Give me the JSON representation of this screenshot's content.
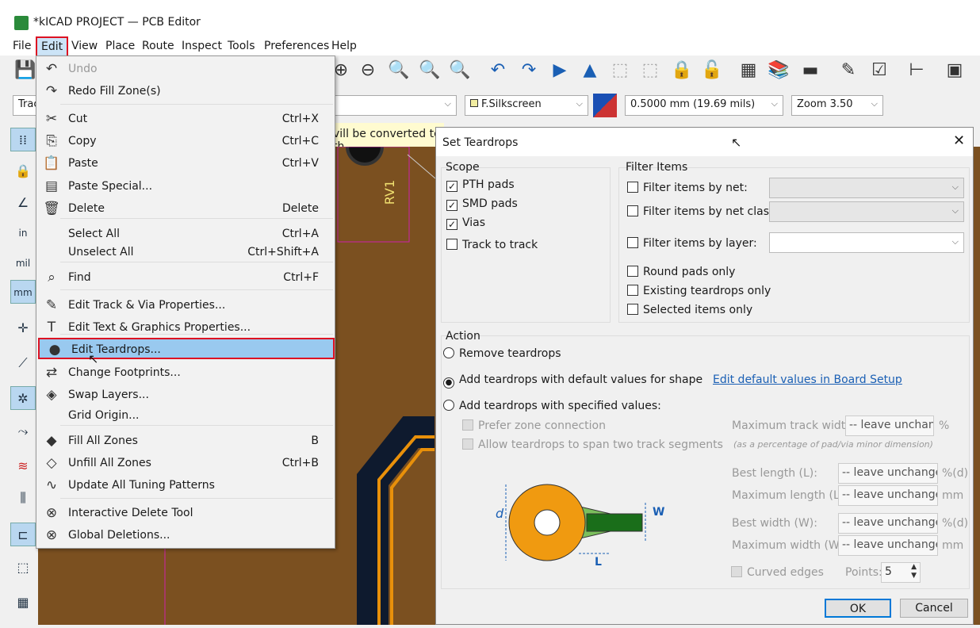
{
  "window": {
    "title": "*kICAD PROJECT — PCB Editor"
  },
  "menubar": [
    "File",
    "Edit",
    "View",
    "Place",
    "Route",
    "Inspect",
    "Tools",
    "Preferences",
    "Help"
  ],
  "toolbar2": {
    "track_combo": "Trac",
    "layer": "F.Silkscreen",
    "width": "0.5000 mm (19.69 mils)",
    "zoom": "Zoom 3.50"
  },
  "infobar": {
    "text": "vill be converted to th"
  },
  "canvas": {
    "ref_label": "RV1"
  },
  "edit_menu": {
    "items": [
      {
        "icon": "undo-icon",
        "glyph": "↶",
        "label": "Undo",
        "shortcut": "",
        "disabled": true
      },
      {
        "icon": "redo-icon",
        "glyph": "↷",
        "label": "Redo Fill Zone(s)",
        "shortcut": ""
      },
      {
        "icon": "cut-icon",
        "glyph": "✂",
        "label": "Cut",
        "shortcut": "Ctrl+X"
      },
      {
        "icon": "copy-icon",
        "glyph": "⎘",
        "label": "Copy",
        "shortcut": "Ctrl+C"
      },
      {
        "icon": "paste-icon",
        "glyph": "📋",
        "label": "Paste",
        "shortcut": "Ctrl+V"
      },
      {
        "icon": "paste-special-icon",
        "glyph": "▤",
        "label": "Paste Special...",
        "shortcut": ""
      },
      {
        "icon": "delete-icon",
        "glyph": "🗑",
        "label": "Delete",
        "shortcut": "Delete"
      },
      {
        "icon": "",
        "glyph": "",
        "label": "Select All",
        "shortcut": "Ctrl+A"
      },
      {
        "icon": "",
        "glyph": "",
        "label": "Unselect All",
        "shortcut": "Ctrl+Shift+A"
      },
      {
        "icon": "find-icon",
        "glyph": "⌕",
        "label": "Find",
        "shortcut": "Ctrl+F"
      },
      {
        "icon": "edit-track-icon",
        "glyph": "✎",
        "label": "Edit Track & Via Properties...",
        "shortcut": ""
      },
      {
        "icon": "text-icon",
        "glyph": "T",
        "label": "Edit Text & Graphics Properties...",
        "shortcut": ""
      },
      {
        "icon": "teardrop-icon",
        "glyph": "●",
        "label": "Edit Teardrops...",
        "shortcut": ""
      },
      {
        "icon": "change-footprint-icon",
        "glyph": "⇄",
        "label": "Change Footprints...",
        "shortcut": ""
      },
      {
        "icon": "swap-layers-icon",
        "glyph": "◈",
        "label": "Swap Layers...",
        "shortcut": ""
      },
      {
        "icon": "",
        "glyph": "",
        "label": "Grid Origin...",
        "shortcut": ""
      },
      {
        "icon": "fill-zones-icon",
        "glyph": "◆",
        "label": "Fill All Zones",
        "shortcut": "B"
      },
      {
        "icon": "unfill-zones-icon",
        "glyph": "◇",
        "label": "Unfill All Zones",
        "shortcut": "Ctrl+B"
      },
      {
        "icon": "tuning-icon",
        "glyph": "∿",
        "label": "Update All Tuning Patterns",
        "shortcut": ""
      },
      {
        "icon": "interactive-delete-icon",
        "glyph": "⊗",
        "label": "Interactive Delete Tool",
        "shortcut": ""
      },
      {
        "icon": "global-delete-icon",
        "glyph": "⊗",
        "label": "Global Deletions...",
        "shortcut": ""
      }
    ]
  },
  "dialog": {
    "title": "Set Teardrops",
    "scope": {
      "title": "Scope",
      "items": [
        {
          "label": "PTH pads",
          "checked": true
        },
        {
          "label": "SMD pads",
          "checked": true
        },
        {
          "label": "Vias",
          "checked": true
        },
        {
          "label": "Track to track",
          "checked": false
        }
      ]
    },
    "filter": {
      "title": "Filter Items",
      "by_net": "Filter items by net:",
      "by_net_class": "Filter items by net class:",
      "by_layer": "Filter items by layer:",
      "round_pads": "Round pads only",
      "existing": "Existing teardrops only",
      "selected": "Selected items only"
    },
    "action": {
      "title": "Action",
      "remove": "Remove teardrops",
      "add_default": "Add teardrops with default values for shape",
      "edit_default_link": "Edit default values in Board Setup",
      "add_specified": "Add teardrops with specified values:",
      "selected": "add_default",
      "prefer_zone": "Prefer zone connection",
      "allow_span": "Allow teardrops to span two track segments"
    },
    "params": {
      "max_track_width": "Maximum track width:",
      "max_track_width_value": "-- leave unchanged --",
      "pct": "%",
      "note": "(as a percentage of pad/via minor dimension)",
      "best_length": "Best length (L):",
      "max_length": "Maximum length (L):",
      "best_width": "Best width (W):",
      "max_width": "Maximum width (W):",
      "value": "-- leave unchanged --",
      "unit_pct_d": "%(d)",
      "unit_mm": "mm",
      "curved_edges": "Curved edges",
      "points_label": "Points:",
      "points": "5"
    },
    "diagram": {
      "d": "d",
      "w": "W",
      "l": "L"
    },
    "ok": "OK",
    "cancel": "Cancel"
  }
}
